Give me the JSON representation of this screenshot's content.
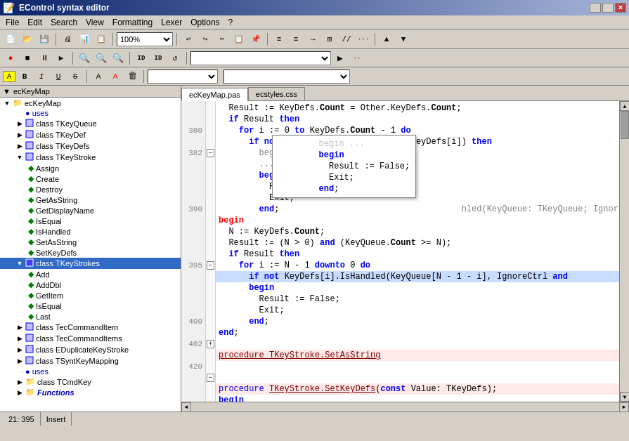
{
  "titleBar": {
    "title": "EControl syntax editor",
    "icon": "📝",
    "minimizeLabel": "_",
    "maximizeLabel": "□",
    "closeLabel": "✕"
  },
  "menuBar": {
    "items": [
      "File",
      "Edit",
      "Search",
      "View",
      "Formatting",
      "Lexer",
      "Options",
      "?"
    ]
  },
  "toolbar": {
    "zoomValue": "100%"
  },
  "tabs": [
    {
      "label": "ecKeyMap.pas",
      "active": true
    },
    {
      "label": "ecstyles.css",
      "active": false
    }
  ],
  "treeHeader": {
    "label": "ecKeyMap"
  },
  "treeItems": [
    {
      "indent": 0,
      "toggle": "▼",
      "icon": "📁",
      "label": "ecKeyMap",
      "type": "root"
    },
    {
      "indent": 1,
      "toggle": "",
      "icon": "🔵",
      "label": "uses",
      "type": "uses"
    },
    {
      "indent": 1,
      "toggle": "▶",
      "icon": "📋",
      "label": "class TKeyQueue",
      "type": "class"
    },
    {
      "indent": 1,
      "toggle": "▶",
      "icon": "📋",
      "label": "class TKeyDef",
      "type": "class"
    },
    {
      "indent": 1,
      "toggle": "▶",
      "icon": "📋",
      "label": "class TKeyDefs",
      "type": "class"
    },
    {
      "indent": 1,
      "toggle": "▼",
      "icon": "📋",
      "label": "class TKeyStroke",
      "type": "class",
      "expanded": true
    },
    {
      "indent": 2,
      "toggle": "",
      "icon": "🔷",
      "label": "Assign",
      "type": "method"
    },
    {
      "indent": 2,
      "toggle": "",
      "icon": "🔷",
      "label": "Create",
      "type": "method"
    },
    {
      "indent": 2,
      "toggle": "",
      "icon": "🔷",
      "label": "Destroy",
      "type": "method"
    },
    {
      "indent": 2,
      "toggle": "",
      "icon": "🔷",
      "label": "GetAsString",
      "type": "method"
    },
    {
      "indent": 2,
      "toggle": "",
      "icon": "🔷",
      "label": "GetDisplayName",
      "type": "method"
    },
    {
      "indent": 2,
      "toggle": "",
      "icon": "🔷",
      "label": "IsEqual",
      "type": "method"
    },
    {
      "indent": 2,
      "toggle": "",
      "icon": "🔷",
      "label": "IsHandled",
      "type": "method"
    },
    {
      "indent": 2,
      "toggle": "",
      "icon": "🔷",
      "label": "SetAsString",
      "type": "method"
    },
    {
      "indent": 2,
      "toggle": "",
      "icon": "🔷",
      "label": "SetKeyDefs",
      "type": "method"
    },
    {
      "indent": 1,
      "toggle": "▼",
      "icon": "📋",
      "label": "class TKeyStrokes",
      "type": "class",
      "selected": true
    },
    {
      "indent": 2,
      "toggle": "",
      "icon": "🔷",
      "label": "Add",
      "type": "method"
    },
    {
      "indent": 2,
      "toggle": "",
      "icon": "🔷",
      "label": "AddDbl",
      "type": "method"
    },
    {
      "indent": 2,
      "toggle": "",
      "icon": "🔷",
      "label": "GetItem",
      "type": "method"
    },
    {
      "indent": 2,
      "toggle": "",
      "icon": "🔷",
      "label": "IsEqual",
      "type": "method"
    },
    {
      "indent": 2,
      "toggle": "",
      "icon": "🔷",
      "label": "Last",
      "type": "method"
    },
    {
      "indent": 1,
      "toggle": "▶",
      "icon": "📋",
      "label": "class TecCommandItem",
      "type": "class"
    },
    {
      "indent": 1,
      "toggle": "▶",
      "icon": "📋",
      "label": "class TecCommandItems",
      "type": "class"
    },
    {
      "indent": 1,
      "toggle": "▶",
      "icon": "📋",
      "label": "class EDuplicateKeyStroke",
      "type": "class"
    },
    {
      "indent": 1,
      "toggle": "▶",
      "icon": "📋",
      "label": "class TSyntKeyMapping",
      "type": "class"
    },
    {
      "indent": 1,
      "toggle": "",
      "icon": "🔵",
      "label": "uses",
      "type": "uses"
    },
    {
      "indent": 1,
      "toggle": "▶",
      "icon": "📁",
      "label": "class TCmdKey",
      "type": "class"
    },
    {
      "indent": 1,
      "toggle": "▶",
      "icon": "📁",
      "label": "Functions",
      "type": "functions",
      "italic": true
    }
  ],
  "codeLines": [
    {
      "num": "",
      "fold": "",
      "content": "  Result := KeyDefs.Count = Other.KeyDefs.Count;",
      "tokens": [
        {
          "text": "  Result := KeyDefs.",
          "color": "id"
        },
        {
          "text": "Count",
          "color": "id",
          "bold": true
        },
        {
          "text": " = Other.KeyDefs.",
          "color": "id"
        },
        {
          "text": "Count",
          "color": "id",
          "bold": true
        },
        {
          "text": ";",
          "color": "id"
        }
      ]
    },
    {
      "num": "",
      "fold": "",
      "content": "  if Result then",
      "tokens": [
        {
          "text": "  ",
          "color": "id"
        },
        {
          "text": "if",
          "color": "kw"
        },
        {
          "text": " Result ",
          "color": "id"
        },
        {
          "text": "then",
          "color": "kw"
        }
      ]
    },
    {
      "num": "380",
      "fold": "",
      "content": "    for i := 0 to KeyDefs.Count - 1 do",
      "tokens": [
        {
          "text": "    ",
          "color": "id"
        },
        {
          "text": "for",
          "color": "kw"
        },
        {
          "text": " i := 0 ",
          "color": "id"
        },
        {
          "text": "to",
          "color": "kw"
        },
        {
          "text": " KeyDefs.",
          "color": "id"
        },
        {
          "text": "Count",
          "color": "id",
          "bold": true
        },
        {
          "text": " - 1 ",
          "color": "id"
        },
        {
          "text": "do",
          "color": "kw"
        }
      ]
    },
    {
      "num": "",
      "fold": "",
      "content": "      if not KeyDefs[i].IsEqual(Other.KeyDefs[i]) then",
      "tokens": [
        {
          "text": "      ",
          "color": "id"
        },
        {
          "text": "if",
          "color": "kw"
        },
        {
          "text": " ",
          "color": "id"
        },
        {
          "text": "not",
          "color": "kw"
        },
        {
          "text": " KeyDefs[i].IsEqual(Other.KeyDefs[i]) ",
          "color": "id"
        },
        {
          "text": "then",
          "color": "kw"
        }
      ]
    },
    {
      "num": "382",
      "fold": "fold",
      "content": "        begin ...",
      "comment": true
    },
    {
      "num": "",
      "fold": "",
      "content": "        begin",
      "tokens": [
        {
          "text": "        ",
          "color": "id"
        },
        {
          "text": "begin",
          "color": "kw"
        }
      ]
    },
    {
      "num": "",
      "fold": "",
      "content": "          Result := False;",
      "tokens": [
        {
          "text": "          Result := False;",
          "color": "id"
        }
      ]
    },
    {
      "num": "",
      "fold": "",
      "content": "          Exit;",
      "tokens": [
        {
          "text": "          Exit;",
          "color": "id"
        }
      ]
    },
    {
      "num": "",
      "fold": "",
      "content": "        end;",
      "tokens": [
        {
          "text": "        ",
          "color": "id"
        },
        {
          "text": "end",
          "color": "kw"
        },
        {
          "text": ";",
          "color": "id"
        }
      ]
    },
    {
      "num": "390",
      "fold": "",
      "content": "begin",
      "tokens": [
        {
          "text": "begin",
          "color": "kw"
        }
      ],
      "highlight": "begin"
    },
    {
      "num": "",
      "fold": "",
      "content": "  N := KeyDefs.Count;",
      "tokens": [
        {
          "text": "  N := KeyDefs.",
          "color": "id"
        },
        {
          "text": "Count",
          "color": "id",
          "bold": true
        },
        {
          "text": ";",
          "color": "id"
        }
      ]
    },
    {
      "num": "",
      "fold": "",
      "content": "  Result := (N > 0) and (KeyQueue.Count >= N);",
      "tokens": [
        {
          "text": "  Result := (N > 0) ",
          "color": "id"
        },
        {
          "text": "and",
          "color": "kw"
        },
        {
          "text": " (KeyQueue.",
          "color": "id"
        },
        {
          "text": "Count",
          "color": "id",
          "bold": true
        },
        {
          "text": " >= N);",
          "color": "id"
        }
      ]
    },
    {
      "num": "",
      "fold": "",
      "content": "  if Result then",
      "tokens": [
        {
          "text": "  ",
          "color": "id"
        },
        {
          "text": "if",
          "color": "kw"
        },
        {
          "text": " Result ",
          "color": "id"
        },
        {
          "text": "then",
          "color": "kw"
        }
      ]
    },
    {
      "num": "",
      "fold": "",
      "content": "    for i := N - 1 downto 0 do",
      "tokens": [
        {
          "text": "    ",
          "color": "id"
        },
        {
          "text": "for",
          "color": "kw"
        },
        {
          "text": " i := N - 1 ",
          "color": "id"
        },
        {
          "text": "downto",
          "color": "kw"
        },
        {
          "text": " 0 ",
          "color": "id"
        },
        {
          "text": "do",
          "color": "kw"
        }
      ]
    },
    {
      "num": "395",
      "fold": "fold",
      "content": "      if not KeyDefs[i].IsHandled(KeyQueue[N - 1 - i], IgnoreCtrl and",
      "highlight": true
    },
    {
      "num": "",
      "fold": "",
      "content": "      begin",
      "tokens": [
        {
          "text": "      ",
          "color": "id"
        },
        {
          "text": "begin",
          "color": "kw"
        }
      ]
    },
    {
      "num": "",
      "fold": "",
      "content": "        Result := False;",
      "tokens": [
        {
          "text": "        Result := False;",
          "color": "id"
        }
      ]
    },
    {
      "num": "",
      "fold": "",
      "content": "        Exit;",
      "tokens": [
        {
          "text": "        Exit;",
          "color": "id"
        }
      ]
    },
    {
      "num": "",
      "fold": "",
      "content": "      end;",
      "tokens": [
        {
          "text": "      ",
          "color": "id"
        },
        {
          "text": "end",
          "color": "kw"
        },
        {
          "text": ";",
          "color": "id"
        }
      ]
    },
    {
      "num": "400",
      "fold": "",
      "content": "end;",
      "tokens": [
        {
          "text": "end",
          "color": "kw"
        },
        {
          "text": ";",
          "color": "id"
        }
      ]
    },
    {
      "num": "",
      "fold": "",
      "content": ""
    },
    {
      "num": "402",
      "fold": "fold",
      "content": "procedure TKeyStroke.SetAsString",
      "proc": true
    },
    {
      "num": "",
      "fold": "",
      "content": ""
    },
    {
      "num": "420",
      "fold": "",
      "content": ""
    },
    {
      "num": "",
      "fold": "fold",
      "content": "procedure TKeyStroke.SetKeyDefs(const Value: TKeyDefs);",
      "proc": true
    },
    {
      "num": "",
      "fold": "",
      "content": "begin",
      "tokens": [
        {
          "text": "begin",
          "color": "kw"
        }
      ]
    }
  ],
  "popup": {
    "lines": [
      "        begin ...",
      "        begin",
      "          Result := False;",
      "          Exit;",
      "        end;"
    ]
  },
  "statusBar": {
    "position": "21: 395",
    "mode": "Insert"
  }
}
